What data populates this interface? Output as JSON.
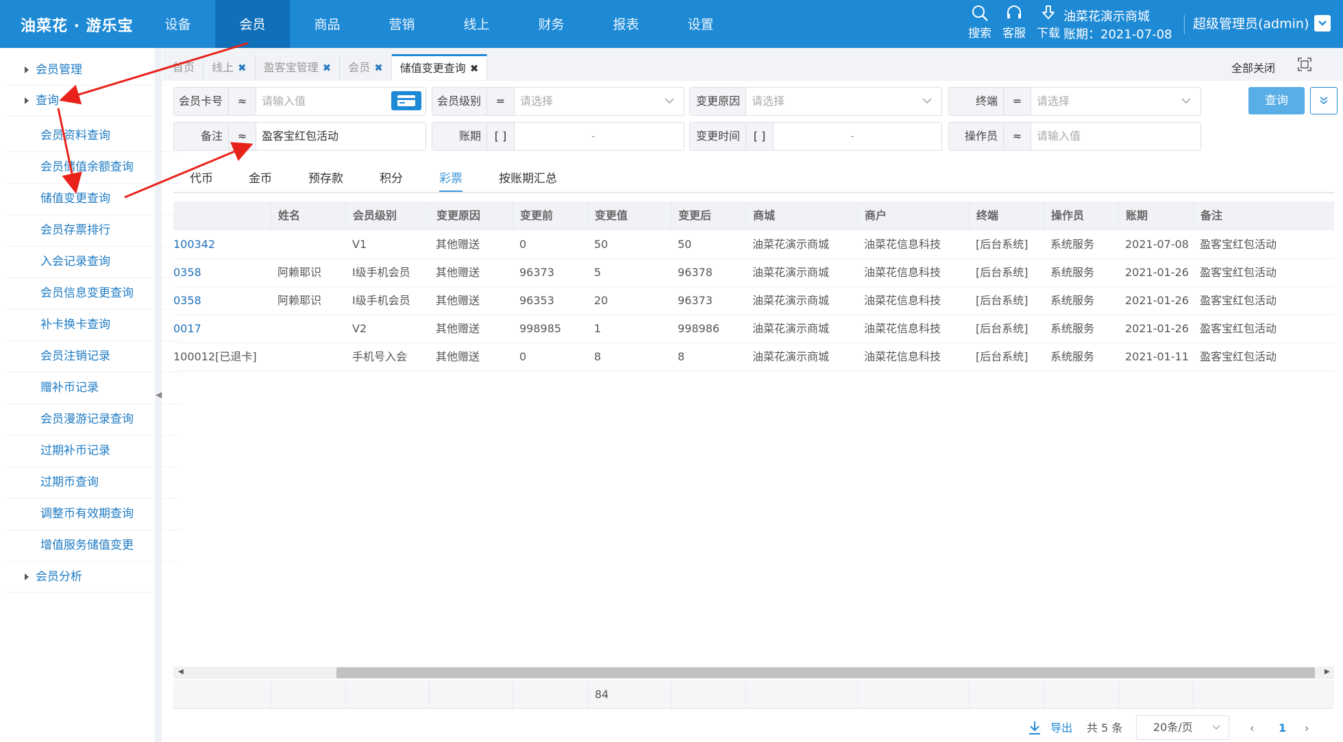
{
  "app": {
    "logo": "油菜花 · 游乐宝",
    "nav": [
      "设备",
      "会员",
      "商品",
      "营销",
      "线上",
      "财务",
      "报表",
      "设置"
    ],
    "nav_active": 1,
    "tools": [
      {
        "label": "搜索",
        "icon": "search-icon"
      },
      {
        "label": "客服",
        "icon": "headset-icon"
      },
      {
        "label": "下载",
        "icon": "download-icon"
      }
    ],
    "shop_name": "油菜花演示商城",
    "period": "账期：2021-07-08",
    "user": "超级管理员(admin)"
  },
  "sidebar": {
    "groups": [
      {
        "label": "会员管理"
      },
      {
        "label": "查询"
      }
    ],
    "items": [
      "会员资料查询",
      "会员储值余额查询",
      "储值变更查询",
      "会员存票排行",
      "入会记录查询",
      "会员信息变更查询",
      "补卡换卡查询",
      "会员注销记录",
      "赠补币记录",
      "会员漫游记录查询",
      "过期补币记录",
      "过期币查询",
      "调整币有效期查询",
      "增值服务储值变更"
    ],
    "analysis": "会员分析"
  },
  "tabs": [
    {
      "label": "首页",
      "closable": false
    },
    {
      "label": "线上",
      "closable": true
    },
    {
      "label": "盈客宝管理",
      "closable": true
    },
    {
      "label": "会员",
      "closable": true
    },
    {
      "label": "储值变更查询",
      "closable": true,
      "active": true
    }
  ],
  "close_all": "全部关闭",
  "filters": {
    "card_no": {
      "label": "会员卡号",
      "op": "≈",
      "placeholder": "请输入值"
    },
    "level": {
      "label": "会员级别",
      "op": "=",
      "placeholder": "请选择"
    },
    "reason": {
      "label": "变更原因",
      "placeholder": "请选择"
    },
    "terminal": {
      "label": "终端",
      "op": "=",
      "placeholder": "请选择"
    },
    "remark": {
      "label": "备注",
      "op": "≈",
      "value": "盈客宝红包活动"
    },
    "period": {
      "label": "账期",
      "op": "[ ]",
      "dash": "-"
    },
    "change_time": {
      "label": "变更时间",
      "op": "[ ]",
      "dash": "-"
    },
    "operator": {
      "label": "操作员",
      "op": "≈",
      "placeholder": "请输入值"
    },
    "query_button": "查询"
  },
  "subtabs": [
    "代币",
    "金币",
    "预存款",
    "积分",
    "彩票",
    "按账期汇总"
  ],
  "subtab_active": 4,
  "table": {
    "headers": [
      "",
      "姓名",
      "会员级别",
      "变更原因",
      "变更前",
      "变更值",
      "变更后",
      "商城",
      "商户",
      "终端",
      "操作员",
      "账期",
      "备注"
    ],
    "rows": [
      [
        "100342",
        "",
        "V1",
        "其他赠送",
        "0",
        "50",
        "50",
        "油菜花演示商城",
        "油菜花信息科技",
        "[后台系统]",
        "系统服务",
        "2021-07-08",
        "盈客宝红包活动"
      ],
      [
        "0358",
        "阿赖耶识",
        "I级手机会员",
        "其他赠送",
        "96373",
        "5",
        "96378",
        "油菜花演示商城",
        "油菜花信息科技",
        "[后台系统]",
        "系统服务",
        "2021-01-26",
        "盈客宝红包活动"
      ],
      [
        "0358",
        "阿赖耶识",
        "I级手机会员",
        "其他赠送",
        "96353",
        "20",
        "96373",
        "油菜花演示商城",
        "油菜花信息科技",
        "[后台系统]",
        "系统服务",
        "2021-01-26",
        "盈客宝红包活动"
      ],
      [
        "0017",
        "",
        "V2",
        "其他赠送",
        "998985",
        "1",
        "998986",
        "油菜花演示商城",
        "油菜花信息科技",
        "[后台系统]",
        "系统服务",
        "2021-01-26",
        "盈客宝红包活动"
      ],
      [
        "100012[已退卡]",
        "",
        "手机号入会",
        "其他赠送",
        "0",
        "8",
        "8",
        "油菜花演示商城",
        "油菜花信息科技",
        "[后台系统]",
        "系统服务",
        "2021-01-11",
        "盈客宝红包活动"
      ]
    ],
    "sum_change": "84"
  },
  "footer": {
    "export": "导出",
    "total": "共 5 条",
    "page_size": "20条/页",
    "page": "1"
  },
  "colors": {
    "brand": "#1e8ad6",
    "nav_active": "#0f6fb8",
    "annotation": "#e8221b"
  }
}
